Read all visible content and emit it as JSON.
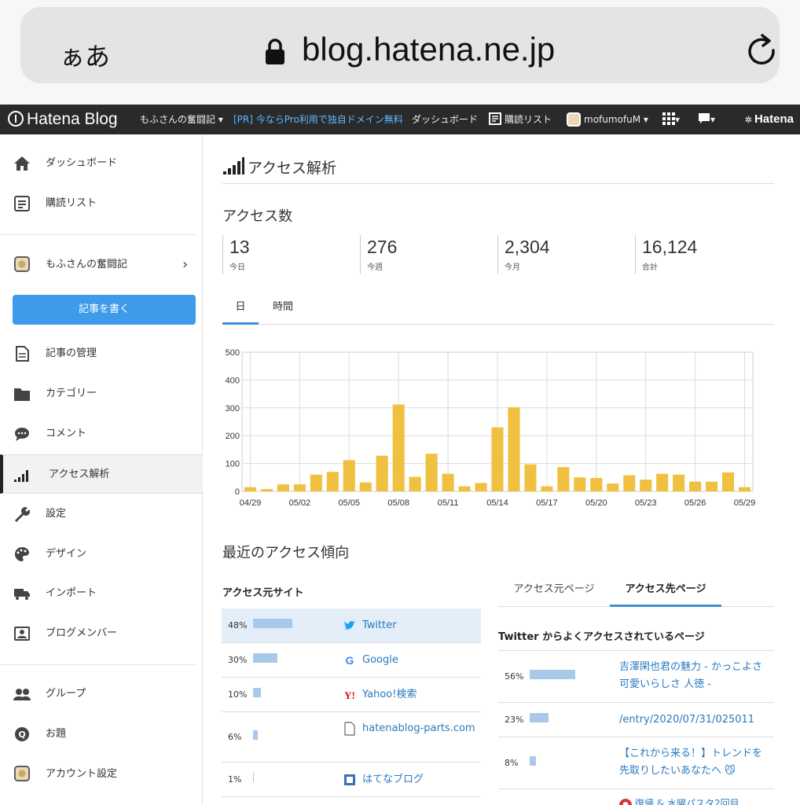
{
  "browser": {
    "aa_label": "ぁあ",
    "url": "blog.hatena.ne.jp"
  },
  "navbar": {
    "logo": "Hatena Blog",
    "blog_menu": "もふさんの奮闘記 ▾",
    "pr": "[PR] 今ならPro利用で独自ドメイン無料",
    "dashboard": "ダッシュボード",
    "reading_list": "購読リスト",
    "user": "mofumofuM ▾",
    "apps": "▾",
    "notifications": "▾",
    "hatena": "Hatena"
  },
  "sidebar": {
    "dashboard": "ダッシュボード",
    "reading_list": "購読リスト",
    "blog_name": "もふさんの奮闘記",
    "write": "記事を書く",
    "manage": "記事の管理",
    "category": "カテゴリー",
    "comment": "コメント",
    "access": "アクセス解析",
    "settings": "設定",
    "design": "デザイン",
    "import": "インポート",
    "members": "ブログメンバー",
    "group": "グループ",
    "theme": "お題",
    "account": "アカウント設定"
  },
  "main": {
    "title": "アクセス解析",
    "access_title": "アクセス数",
    "stats": [
      {
        "value": "13",
        "label": "今日"
      },
      {
        "value": "276",
        "label": "今週"
      },
      {
        "value": "2,304",
        "label": "今月"
      },
      {
        "value": "16,124",
        "label": "合計"
      }
    ],
    "tabs": [
      "日",
      "時間"
    ],
    "recent_title": "最近のアクセス傾向",
    "ref_head": "アクセス元サイト",
    "referrers": [
      {
        "pct": "48%",
        "ratio": 0.48,
        "site": "Twitter",
        "icon": "twitter-icon"
      },
      {
        "pct": "30%",
        "ratio": 0.3,
        "site": "Google",
        "icon": "google-icon"
      },
      {
        "pct": "10%",
        "ratio": 0.1,
        "site": "Yahoo!検索",
        "icon": "yahoo-icon"
      },
      {
        "pct": "6%",
        "ratio": 0.06,
        "site": "hatenablog-parts.com",
        "icon": "document-icon"
      },
      {
        "pct": "1%",
        "ratio": 0.01,
        "site": "はてなブログ",
        "icon": "hatena-blog-icon"
      }
    ],
    "right_tabs": [
      "アクセス元ページ",
      "アクセス先ページ"
    ],
    "pop_head": "Twitter からよくアクセスされているページ",
    "pages": [
      {
        "pct": "56%",
        "ratio": 0.56,
        "title": "吉澤閑也君の魅力 - かっこよさ 可愛いらしさ 人徳 -"
      },
      {
        "pct": "23%",
        "ratio": 0.23,
        "title": "/entry/2020/07/31/025011"
      },
      {
        "pct": "8%",
        "ratio": 0.08,
        "title": "【これから来る！】トレンドを先取りしたいあなたへ 😼"
      }
    ],
    "cut_off_text": "復帰 & 水曜パスタ2回目"
  },
  "colors": {
    "navbar_bg": "#2a2a2a",
    "accent_blue": "#3d9be9",
    "bar_color": "#f0c040",
    "link_color": "#2a7ac0"
  },
  "chart_data": {
    "type": "bar",
    "categories": [
      "04/29",
      "04/30",
      "05/01",
      "05/02",
      "05/03",
      "05/04",
      "05/05",
      "05/06",
      "05/07",
      "05/08",
      "05/09",
      "05/10",
      "05/11",
      "05/12",
      "05/13",
      "05/14",
      "05/15",
      "05/16",
      "05/17",
      "05/18",
      "05/19",
      "05/20",
      "05/21",
      "05/22",
      "05/23",
      "05/24",
      "05/25",
      "05/26",
      "05/27",
      "05/28",
      "05/29"
    ],
    "tick_labels": [
      "04/29",
      "05/02",
      "05/05",
      "05/08",
      "05/11",
      "05/14",
      "05/17",
      "05/20",
      "05/23",
      "05/26",
      "05/29"
    ],
    "values": [
      15,
      8,
      25,
      25,
      60,
      70,
      112,
      32,
      128,
      312,
      52,
      135,
      63,
      18,
      30,
      230,
      302,
      97,
      18,
      87,
      50,
      48,
      28,
      58,
      42,
      63,
      60,
      35,
      35,
      68,
      15
    ],
    "ylim": [
      0,
      500
    ],
    "yticks": [
      0,
      100,
      200,
      300,
      400,
      500
    ],
    "grid": true
  }
}
